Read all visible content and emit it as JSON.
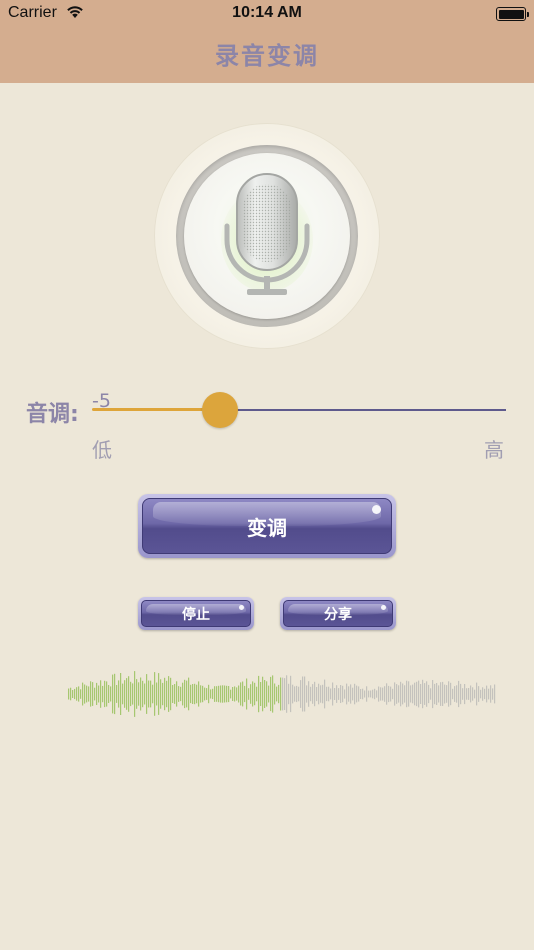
{
  "status_bar": {
    "carrier": "Carrier",
    "time": "10:14 AM",
    "battery_level": 1.0
  },
  "nav": {
    "title": "录音变调",
    "background_color": "#d4ad8f",
    "title_color": "#8c85a8"
  },
  "recorder": {
    "microphone_icon": "microphone-icon"
  },
  "pitch": {
    "label": "音调:",
    "value_text": "-5",
    "value": -5,
    "min": -12,
    "max": 12,
    "low_label": "低",
    "high_label": "高",
    "min_track_color": "#dea53a",
    "max_track_color": "#5e5a8c"
  },
  "buttons": {
    "change_voice": "变调",
    "stop": "停止",
    "share": "分享"
  },
  "waveform": {
    "played_fraction": 0.5,
    "played_color": "#a6c770",
    "unplayed_color": "#c4c2bd"
  },
  "colors": {
    "background": "#ede7d8",
    "button_purple": "#6e68a8"
  }
}
